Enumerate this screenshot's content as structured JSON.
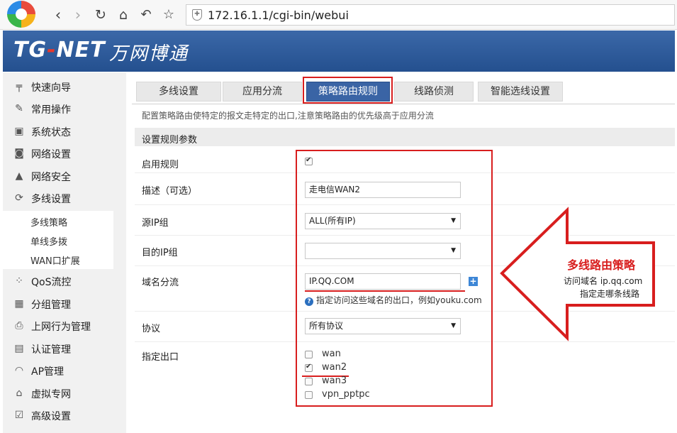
{
  "browser": {
    "back_icon": "chevron-left-icon",
    "forward_icon": "chevron-right-icon",
    "url": "172.16.1.1/cgi-bin/webui"
  },
  "banner": {
    "logo_part1": "TG",
    "logo_dash": "-",
    "logo_part2": "NET",
    "logo_cn": "万网博通"
  },
  "sidebar": {
    "items": [
      {
        "label": "快速向导",
        "icon": "pin-icon"
      },
      {
        "label": "常用操作",
        "icon": "wrench-icon"
      },
      {
        "label": "系统状态",
        "icon": "monitor-icon"
      },
      {
        "label": "网络设置",
        "icon": "network-icon"
      },
      {
        "label": "网络安全",
        "icon": "security-icon"
      },
      {
        "label": "多线设置",
        "icon": "multiline-icon"
      },
      {
        "label": "QoS流控",
        "icon": "qos-icon"
      },
      {
        "label": "分组管理",
        "icon": "group-icon"
      },
      {
        "label": "上网行为管理",
        "icon": "behavior-icon"
      },
      {
        "label": "认证管理",
        "icon": "auth-icon"
      },
      {
        "label": "AP管理",
        "icon": "ap-icon"
      },
      {
        "label": "虚拟专网",
        "icon": "vpn-icon"
      },
      {
        "label": "高级设置",
        "icon": "advanced-icon"
      }
    ],
    "sub_items": [
      "多线策略",
      "单线多拨",
      "WAN口扩展"
    ]
  },
  "tabs": [
    "多线设置",
    "应用分流",
    "策略路由规则",
    "线路侦测",
    "智能选线设置"
  ],
  "active_tab": 2,
  "description": "配置策略路由使特定的报文走特定的出口,注意策略路由的优先级高于应用分流",
  "section_title": "设置规则参数",
  "form": {
    "enable_label": "启用规则",
    "enable_checked": true,
    "desc_label": "描述（可选）",
    "desc_value": "走电信WAN2",
    "src_ip_label": "源IP组",
    "src_ip_value": "ALL(所有IP)",
    "dst_ip_label": "目的IP组",
    "dst_ip_value": "",
    "domain_label": "域名分流",
    "domain_value": "IP.QQ.COM",
    "domain_hint": "指定访问这些域名的出口，例如youku.com",
    "protocol_label": "协议",
    "protocol_value": "所有协议",
    "outlet_label": "指定出口",
    "outlets": [
      {
        "name": "wan",
        "checked": false
      },
      {
        "name": "wan2",
        "checked": true
      },
      {
        "name": "wan3",
        "checked": false
      },
      {
        "name": "vpn_pptpc",
        "checked": false
      }
    ]
  },
  "annotation": {
    "title": "多线路由策略",
    "line1": "访问域名 ip.qq.com",
    "line2": "指定走哪条线路"
  },
  "colors": {
    "accent_red": "#d81e1e",
    "banner_blue": "#2c5897",
    "active_tab": "#3a64a5"
  }
}
